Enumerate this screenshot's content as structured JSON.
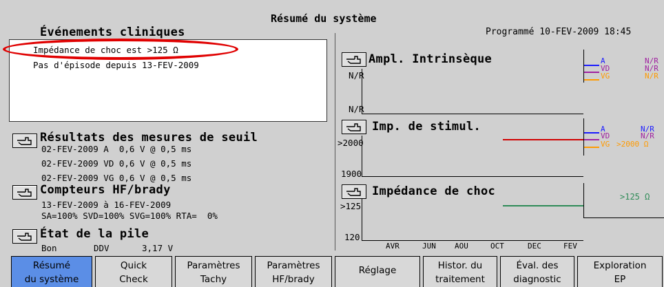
{
  "window": {
    "title": "Résumé du système",
    "programmed": "Programmé 10-FEV-2009 18:45"
  },
  "events": {
    "title": "Événements cliniques",
    "items": [
      "Impédance de choc est >125 Ω",
      "Pas d'épisode depuis 13-FEV-2009"
    ]
  },
  "thresholds": {
    "title": "Résultats des mesures de seuil",
    "rows": [
      "02-FEV-2009 A  0,6 V @ 0,5 ms",
      "02-FEV-2009 VD 0,6 V @ 0,5 ms",
      "02-FEV-2009 VG 0,6 V @ 0,5 ms"
    ]
  },
  "counters": {
    "title": "Compteurs HF/brady",
    "range": "13-FEV-2009 à 16-FEV-2009",
    "stats": "SA=100% SVD=100% SVG=100% RTA=  0%"
  },
  "battery": {
    "title": "État de la pile",
    "status": "Bon",
    "ddv": "DDV",
    "voltage": "3,17 V"
  },
  "ampl": {
    "title": "Ampl. Intrinsèque",
    "y_top": "N/R",
    "y_bottom": "N/R",
    "legend": [
      {
        "name": "A",
        "value": "N/R",
        "color": "#1a1aff"
      },
      {
        "name": "VD",
        "value": "N/R",
        "color": "#a020a0"
      },
      {
        "name": "VG",
        "value": "N/R",
        "color": "#ff9a00"
      }
    ]
  },
  "stim": {
    "title": "Imp. de stimul.",
    "y_top": ">2000",
    "y_bottom": "1900",
    "legend": [
      {
        "name": "A",
        "value": "N/R",
        "color": "#1a1aff"
      },
      {
        "name": "VD",
        "value": "N/R",
        "color": "#a020a0"
      },
      {
        "name": "VG",
        "value": ">2000 Ω",
        "color": "#ff9a00"
      }
    ],
    "line_color": "#d00000"
  },
  "shock": {
    "title": "Impédance de choc",
    "y_top": ">125",
    "y_bottom": "120",
    "value": ">125 Ω",
    "value_color": "#2e8b57",
    "line_color": "#2e8b57"
  },
  "x_axis": [
    "AVR",
    "JUN",
    "AOU",
    "OCT",
    "DEC",
    "FEV"
  ],
  "tabs": [
    {
      "label": "Résumé\ndu système",
      "active": true
    },
    {
      "label": "Quick\nCheck",
      "active": false
    },
    {
      "label": "Paramètres\nTachy",
      "active": false
    },
    {
      "label": "Paramètres\nHF/brady",
      "active": false
    },
    {
      "label": "Réglage",
      "active": false
    },
    {
      "label": "Histor. du\ntraitement",
      "active": false
    },
    {
      "label": "Éval. des\ndiagnostic",
      "active": false
    },
    {
      "label": "Exploration\nEP",
      "active": false
    }
  ]
}
